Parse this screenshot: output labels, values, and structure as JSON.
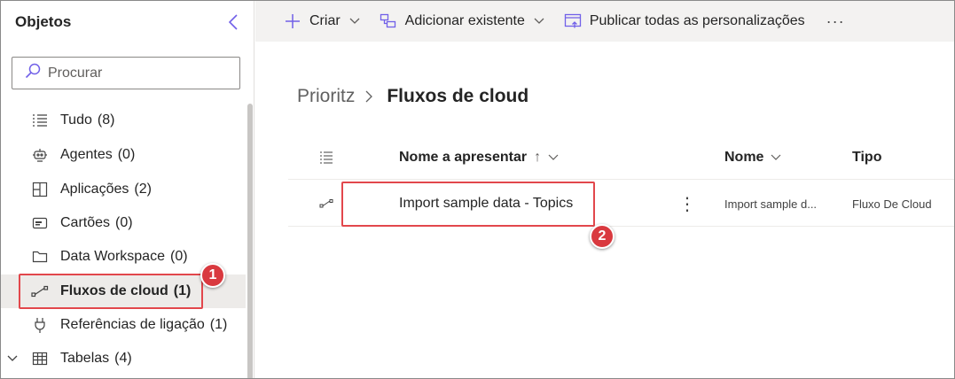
{
  "sidebar": {
    "title": "Objetos",
    "search_placeholder": "Procurar",
    "items": [
      {
        "label": "Tudo",
        "count": "(8)",
        "icon": "list-icon"
      },
      {
        "label": "Agentes",
        "count": "(0)",
        "icon": "bot-icon"
      },
      {
        "label": "Aplicações",
        "count": "(2)",
        "icon": "apps-icon"
      },
      {
        "label": "Cartões",
        "count": "(0)",
        "icon": "card-icon"
      },
      {
        "label": "Data Workspace",
        "count": "(0)",
        "icon": "folder-icon"
      },
      {
        "label": "Fluxos de cloud",
        "count": "(1)",
        "icon": "flow-icon",
        "active": true
      },
      {
        "label": "Referências de ligação",
        "count": "(1)",
        "icon": "plug-icon"
      },
      {
        "label": "Tabelas",
        "count": "(4)",
        "icon": "table-icon"
      }
    ]
  },
  "toolbar": {
    "new_label": "Criar",
    "add_existing_label": "Adicionar existente",
    "publish_label": "Publicar todas as personalizações",
    "more_label": "···"
  },
  "breadcrumb": {
    "parent": "Prioritz",
    "current": "Fluxos de cloud"
  },
  "grid": {
    "columns": {
      "display_name": "Nome a apresentar",
      "sort_arrow": "↑",
      "name": "Nome",
      "type": "Tipo"
    },
    "rows": [
      {
        "display_name": "Import sample data - Topics",
        "name": "Import sample d...",
        "type": "Fluxo De Cloud",
        "more": "⋮"
      }
    ]
  },
  "callouts": {
    "one": "1",
    "two": "2"
  },
  "colors": {
    "highlight": "#e2474c",
    "toolbar_bg": "#f3f2f1",
    "active_bg": "#edebe9"
  }
}
